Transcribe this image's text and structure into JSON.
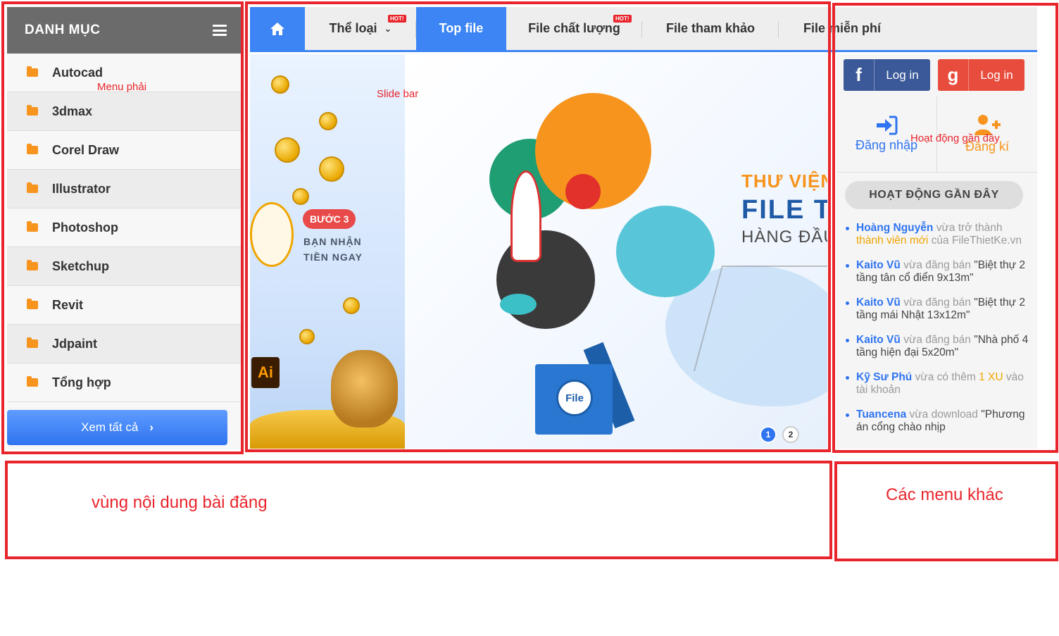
{
  "category_menu": {
    "title": "DANH MỤC",
    "items": [
      {
        "label": "Autocad"
      },
      {
        "label": "3dmax"
      },
      {
        "label": "Corel Draw"
      },
      {
        "label": "Illustrator"
      },
      {
        "label": "Photoshop"
      },
      {
        "label": "Sketchup"
      },
      {
        "label": "Revit"
      },
      {
        "label": "Jdpaint"
      },
      {
        "label": "Tổng hợp"
      }
    ],
    "see_all_label": "Xem tất cả"
  },
  "topnav": {
    "items": [
      {
        "label": "Thể loại",
        "hot": "HOT!",
        "has_dropdown": true
      },
      {
        "label": "Top file",
        "active": true
      },
      {
        "label": "File chất lượng",
        "hot": "HOT!"
      },
      {
        "label": "File tham khảo"
      },
      {
        "label": "File miễn phí"
      }
    ],
    "accent_color": "#3d85f5"
  },
  "slider": {
    "step_badge": "BƯỚC 3",
    "step_text_line1": "BẠN NHẬN",
    "step_text_line2": "TIỀN NGAY",
    "headline1": "THƯ VIỆN",
    "headline2": "FILE T",
    "headline3": "HÀNG ĐẦU",
    "file_logo": "File",
    "ai_badge": "Ai",
    "dots": [
      "1",
      "2"
    ],
    "active_dot": 1
  },
  "sidebar": {
    "facebook_login": "Log in",
    "google_login": "Log in",
    "login_label": "Đăng nhập",
    "register_label": "Đăng kí",
    "recent_title": "HOẠT ĐỘNG GẦN ĐÂY",
    "activities": [
      {
        "user": "Hoàng Nguyễn",
        "text": "vừa trở thành",
        "highlight": "thành viên mới",
        "tail": "của FileThietKe.vn"
      },
      {
        "user": "Kaito Vũ",
        "text": "vừa đăng bán",
        "item": "\"Biệt thự 2 tầng tân cổ điển 9x13m\""
      },
      {
        "user": "Kaito Vũ",
        "text": "vừa đăng bán",
        "item": "\"Biệt thự 2 tầng mái Nhật 13x12m\""
      },
      {
        "user": "Kaito Vũ",
        "text": "vừa đăng bán",
        "item": "\"Nhà phố 4 tầng hiện đại 5x20m\""
      },
      {
        "user": "Kỹ Sư Phú",
        "text": "vừa có thêm",
        "highlight": "1 XU",
        "tail": "vào tài khoản"
      },
      {
        "user": "Tuancena",
        "text": "vừa download",
        "item": "\"Phương án cổng chào nhịp"
      }
    ],
    "facebook_color": "#3b5998",
    "google_color": "#e84c3d"
  },
  "annotations": {
    "menu_right": "Menu phải",
    "slide_bar": "Slide bar",
    "recent_activity": "Hoạt động gần đây",
    "content_area": "vùng nội dung bài đăng",
    "other_menus": "Các menu khác",
    "color": "#e8252c"
  }
}
